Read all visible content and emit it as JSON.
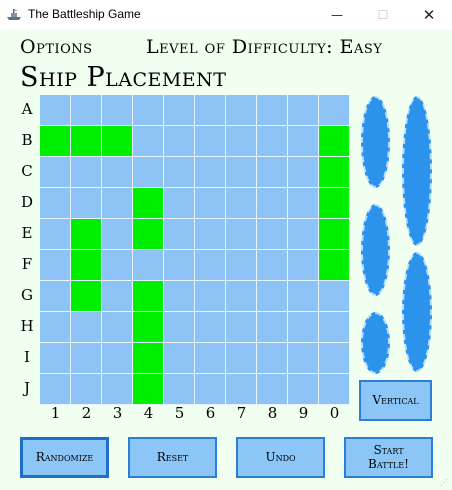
{
  "window": {
    "title": "The Battleship Game",
    "minimize_glyph": "—",
    "maximize_glyph": "☐",
    "close_glyph": "✕"
  },
  "menu": {
    "options_label": "Options",
    "difficulty_label": "Level of Difficulty: Easy"
  },
  "heading": "Ship Placement",
  "board": {
    "rows": [
      "A",
      "B",
      "C",
      "D",
      "E",
      "F",
      "G",
      "H",
      "I",
      "J"
    ],
    "columns": [
      "1",
      "2",
      "3",
      "4",
      "5",
      "6",
      "7",
      "8",
      "9",
      "0"
    ],
    "colors": {
      "water": "#8ec3f6",
      "ship": "#00ef00",
      "dock_ship": "#2b93ec"
    },
    "placed_ships": [
      {
        "cells": [
          "B1",
          "B2",
          "B3"
        ]
      },
      {
        "cells": [
          "B0",
          "C0",
          "D0",
          "E0",
          "F0"
        ]
      },
      {
        "cells": [
          "D4",
          "E4"
        ]
      },
      {
        "cells": [
          "E2",
          "F2",
          "G2"
        ]
      },
      {
        "cells": [
          "G4",
          "H4",
          "I4",
          "J4"
        ]
      }
    ]
  },
  "dock": {
    "icon": "ship-oval-icon"
  },
  "buttons": {
    "vertical": "Vertical",
    "randomize": "Randomize",
    "reset": "Reset",
    "undo": "Undo",
    "start_line1": "Start",
    "start_line2": "Battle!"
  }
}
